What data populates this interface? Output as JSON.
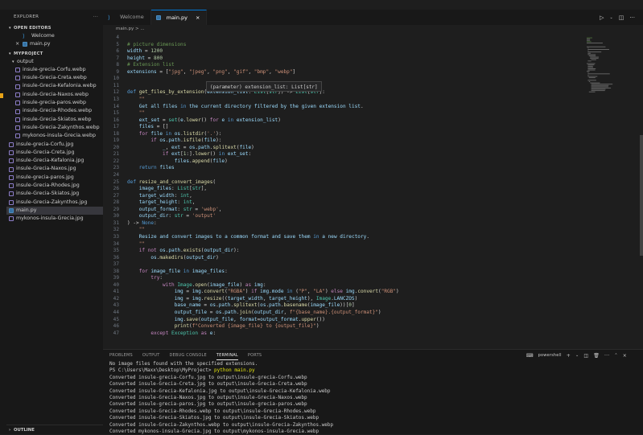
{
  "sidebar": {
    "title": "EXPLORER",
    "open_editors_header": "OPEN EDITORS",
    "open_editors": [
      {
        "name": "Welcome",
        "icon": "vscode-icon"
      },
      {
        "name": "main.py",
        "icon": "python-icon",
        "close": "×"
      }
    ],
    "project_header": "MYPROJECT",
    "folder": "output",
    "output_files": [
      "insule-grecia-Corfu.webp",
      "insule-Grecia-Creta.webp",
      "insule-Grecia-Kefalonia.webp",
      "insule-Grecia-Naxos.webp",
      "insule-grecia-paros.webp",
      "insule-Grecia-Rhodes.webp",
      "insule-Grecia-Skiatos.webp",
      "insule-Grecia-Zakynthos.webp",
      "mykonos-insula-Grecia.webp"
    ],
    "files": [
      "insule-grecia-Corfu.jpg",
      "insule-Grecia-Creta.jpg",
      "insule-Grecia-Kefalonia.jpg",
      "insule-Grecia-Naxos.jpg",
      "insule-grecia-paros.jpg",
      "insule-Grecia-Rhodes.jpg",
      "insule-Grecia-Skiatos.jpg",
      "insule-Grecia-Zakynthos.jpg",
      "main.py",
      "mykonos-insula-Grecia.jpg"
    ],
    "outline_header": "OUTLINE"
  },
  "tabs": [
    {
      "label": "Welcome",
      "icon": "vscode-icon"
    },
    {
      "label": "main.py",
      "icon": "python-icon",
      "close": "×"
    }
  ],
  "breadcrumb": "main.py > ...",
  "tooltip": "(parameter) extension_list: List[str]",
  "editor": {
    "lines": [
      {
        "n": "4",
        "code": ""
      },
      {
        "n": "5",
        "code": "# picture dimensions"
      },
      {
        "n": "6",
        "code": "width = 1200"
      },
      {
        "n": "7",
        "code": "height = 800"
      },
      {
        "n": "8",
        "code": "# Extension list"
      },
      {
        "n": "9",
        "code": "extensions = [\"jpg\", \"jpeg\", \"png\", \"gif\", \"bmp\", \"webp\"]"
      },
      {
        "n": "10",
        "code": ""
      },
      {
        "n": "11",
        "code": ""
      },
      {
        "n": "12",
        "code": "def get_files_by_extension(extension_list: List[str]) -> List[str]:"
      },
      {
        "n": "13",
        "code": "    \"\"\""
      },
      {
        "n": "14",
        "code": "    Get all files in the current directory filtered by the given extension list."
      },
      {
        "n": "15",
        "code": "    \"\"\""
      },
      {
        "n": "16",
        "code": "    ext_set = set(e.lower() for e in extension_list)"
      },
      {
        "n": "17",
        "code": "    files = []"
      },
      {
        "n": "18",
        "code": "    for file in os.listdir('.'):"
      },
      {
        "n": "19",
        "code": "        if os.path.isfile(file):"
      },
      {
        "n": "20",
        "code": "            _, ext = os.path.splitext(file)"
      },
      {
        "n": "21",
        "code": "            if ext[1:].lower() in ext_set:"
      },
      {
        "n": "22",
        "code": "                files.append(file)"
      },
      {
        "n": "23",
        "code": "    return files"
      },
      {
        "n": "24",
        "code": ""
      },
      {
        "n": "25",
        "code": "def resize_and_convert_images("
      },
      {
        "n": "26",
        "code": "    image_files: List[str],"
      },
      {
        "n": "27",
        "code": "    target_width: int,"
      },
      {
        "n": "28",
        "code": "    target_height: int,"
      },
      {
        "n": "29",
        "code": "    output_format: str = 'webp',"
      },
      {
        "n": "30",
        "code": "    output_dir: str = 'output'"
      },
      {
        "n": "31",
        "code": ") -> None:"
      },
      {
        "n": "32",
        "code": "    \"\"\""
      },
      {
        "n": "33",
        "code": "    Resize and convert images to a common format and save them in a new directory."
      },
      {
        "n": "34",
        "code": "    \"\"\""
      },
      {
        "n": "35",
        "code": "    if not os.path.exists(output_dir):"
      },
      {
        "n": "36",
        "code": "        os.makedirs(output_dir)"
      },
      {
        "n": "37",
        "code": ""
      },
      {
        "n": "38",
        "code": "    for image_file in image_files:"
      },
      {
        "n": "39",
        "code": "        try:"
      },
      {
        "n": "40",
        "code": "            with Image.open(image_file) as img:"
      },
      {
        "n": "41",
        "code": "                img = img.convert(\"RGBA\") if img.mode in (\"P\", \"LA\") else img.convert(\"RGB\")"
      },
      {
        "n": "42",
        "code": "                img = img.resize((target_width, target_height), Image.LANCZOS)"
      },
      {
        "n": "43",
        "code": "                base_name = os.path.splitext(os.path.basename(image_file))[0]"
      },
      {
        "n": "44",
        "code": "                output_file = os.path.join(output_dir, f\"{base_name}.{output_format}\")"
      },
      {
        "n": "45",
        "code": "                img.save(output_file, format=output_format.upper())"
      },
      {
        "n": "46",
        "code": "                print(f\"Converted {image_file} to {output_file}\")"
      },
      {
        "n": "47",
        "code": "        except Exception as e:"
      }
    ]
  },
  "panel": {
    "tabs": [
      "PROBLEMS",
      "OUTPUT",
      "DEBUG CONSOLE",
      "TERMINAL",
      "PORTS"
    ],
    "active_tab": "TERMINAL",
    "shell": "powershell",
    "terminal_lines": [
      "No image files found with the specified extensions.",
      "PS C:\\Users\\Maxx\\Desktop\\MyProject> python main.py",
      "Converted insule-grecia-Corfu.jpg to output\\insule-grecia-Corfu.webp",
      "Converted insule-Grecia-Creta.jpg to output\\insule-Grecia-Creta.webp",
      "Converted insule-Grecia-Kefalonia.jpg to output\\insule-Grecia-Kefalonia.webp",
      "Converted insule-Grecia-Naxos.jpg to output\\insule-Grecia-Naxos.webp",
      "Converted insule-grecia-paros.jpg to output\\insule-grecia-paros.webp",
      "Converted insule-Grecia-Rhodes.webp to output\\insule-Grecia-Rhodes.webp",
      "Converted insule-Grecia-Skiatos.jpg to output\\insule-Grecia-Skiatos.webp",
      "Converted insule-Grecia-Zakynthos.webp to output\\insule-Grecia-Zakynthos.webp",
      "Converted mykonos-insula-Grecia.jpg to output\\mykonos-insula-Grecia.webp"
    ]
  },
  "colors": {
    "accent": "#0078d4",
    "sidebar_bg": "#181818",
    "editor_bg": "#1e1e1e"
  }
}
